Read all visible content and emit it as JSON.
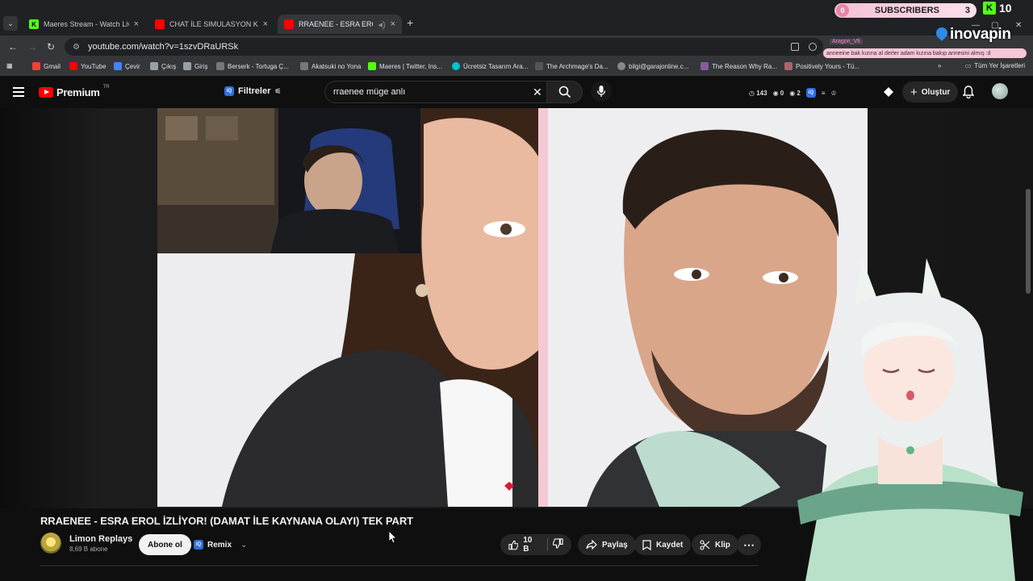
{
  "browser": {
    "tabs": [
      {
        "title": "Maeres Stream - Watch Live on",
        "icon": "kick-icon",
        "color": "#53fc18"
      },
      {
        "title": "CHAT İLE SIMULASYON KEYFİ |",
        "icon": "youtube-icon",
        "color": "#ff0000"
      },
      {
        "title": "RRAENEE - ESRA EROL İZLİY",
        "icon": "youtube-icon",
        "color": "#ff0000"
      }
    ],
    "url": "youtube.com/watch?v=1szvDRaURSk",
    "bookmarks": [
      "Gmail",
      "YouTube",
      "Çevir",
      "Çıkış",
      "Giriş",
      "Berserk - Tortuga Ç...",
      "Akatsuki no Yona",
      "Maeres | Twitter, Ins...",
      "Ücretsiz Tasarım Ara...",
      "The Archmage's Da...",
      "bilgi@garajonline.c...",
      "The Reason Why Ra...",
      "Positively Yours - Tü..."
    ],
    "all_bookmarks": "Tüm Yer İşaretleri"
  },
  "overlay": {
    "subscribers_left": "0",
    "subscribers_label": "SUBSCRIBERS",
    "subscribers_right": "3",
    "kick_count": "10",
    "brand": "inovapin",
    "chat_user": "Aragon_Vfi",
    "chat_message": "anneeine bak kızına al derler adam kızına bakıp annesini almış :d"
  },
  "youtube": {
    "logo_text": "Premium",
    "logo_region": "TR",
    "filters_label": "Filtreler",
    "search_value": "rraenee müge anlı",
    "ext_stats": [
      "143",
      "0",
      "2"
    ],
    "create_label": "Oluştur"
  },
  "video": {
    "title": "RRAENEE - ESRA EROL İZLİYOR! (DAMAT İLE KAYNANA OLAYI) TEK PART",
    "channel_name": "Limon Replays",
    "channel_subs": "8,69 B abone",
    "subscribe_label": "Abone ol",
    "remix_label": "Remix",
    "likes": "10 B",
    "share_label": "Paylaş",
    "save_label": "Kaydet",
    "clip_label": "Klip"
  },
  "colors": {
    "accent": "#ff0000",
    "kick_green": "#53fc18",
    "overlay_pink": "#f4c1d4"
  }
}
